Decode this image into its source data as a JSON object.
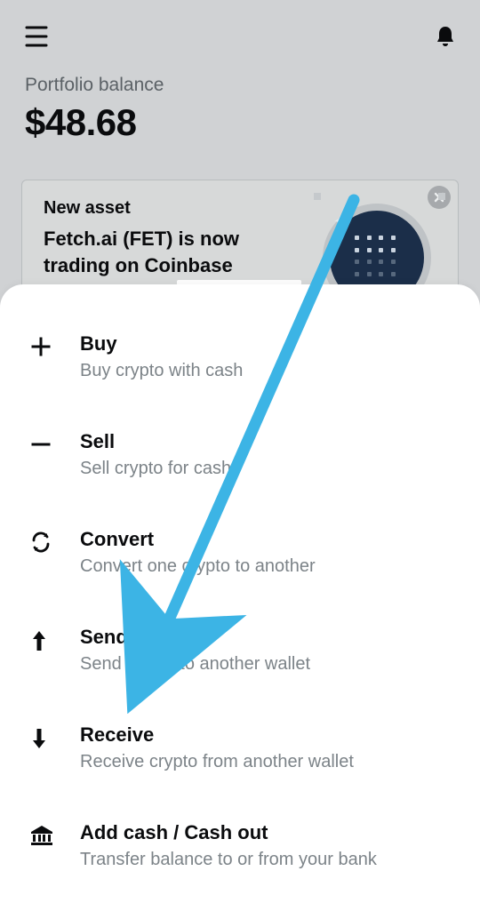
{
  "header": {},
  "balance": {
    "label": "Portfolio balance",
    "value": "$48.68"
  },
  "promo": {
    "label": "New asset",
    "text": "Fetch.ai (FET) is now trading on Coinbase"
  },
  "actions": {
    "buy": {
      "title": "Buy",
      "desc": "Buy crypto with cash"
    },
    "sell": {
      "title": "Sell",
      "desc": "Sell crypto for cash"
    },
    "convert": {
      "title": "Convert",
      "desc": "Convert one crypto to another"
    },
    "send": {
      "title": "Send",
      "desc": "Send crypto to another wallet"
    },
    "receive": {
      "title": "Receive",
      "desc": "Receive crypto from another wallet"
    },
    "cash": {
      "title": "Add cash / Cash out",
      "desc": "Transfer balance to or from your bank"
    }
  }
}
